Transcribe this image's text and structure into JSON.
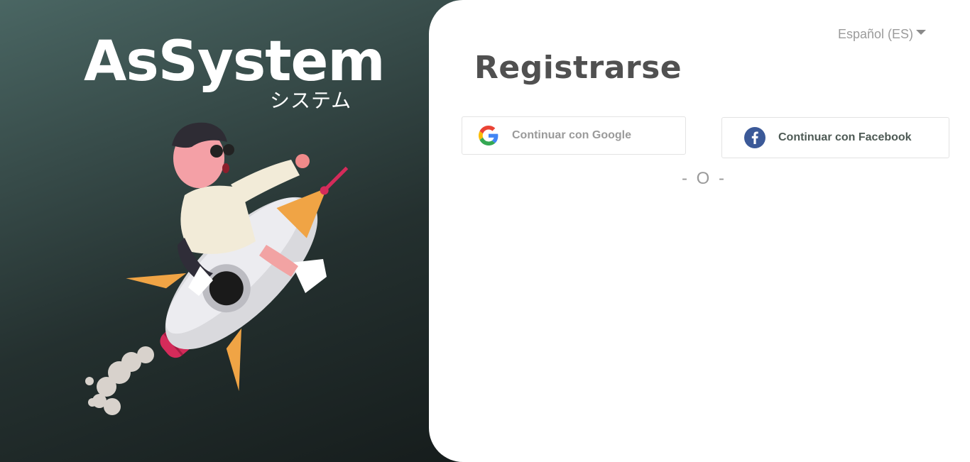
{
  "brand": {
    "logo_text": "AsSystem",
    "logo_subtitle": "システム",
    "illustration_icon": "rocket-rider-illustration"
  },
  "language": {
    "selected": "Español (ES)",
    "icon": "caret-down-icon"
  },
  "form": {
    "title": "Registrarse",
    "google_label": "Continuar con Google",
    "facebook_label": "Continuar con Facebook",
    "divider": "- O -"
  },
  "colors": {
    "panel_gradient_start": "#4a6663",
    "panel_gradient_end": "#0c0f0f",
    "card_background": "#ffffff",
    "title": "#505050",
    "facebook_blue": "#3b5998"
  }
}
